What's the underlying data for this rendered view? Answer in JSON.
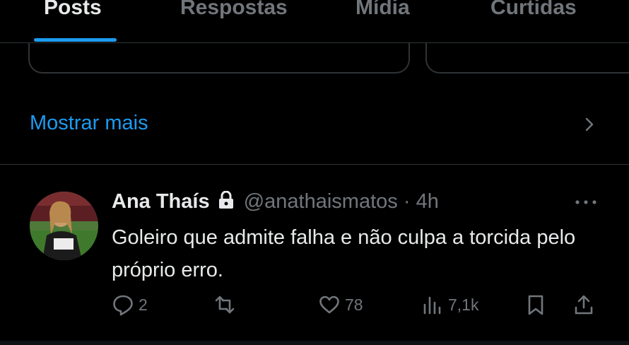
{
  "tabs": [
    {
      "label": "Posts",
      "active": true
    },
    {
      "label": "Respostas",
      "active": false
    },
    {
      "label": "Mídia",
      "active": false
    },
    {
      "label": "Curtidas",
      "active": false
    }
  ],
  "show_more": {
    "label": "Mostrar mais"
  },
  "tweet": {
    "display_name": "Ana Thaís",
    "handle": "@anathaismatos",
    "separator": "·",
    "time": "4h",
    "text": "Goleiro que admite falha e não culpa a torcida pelo próprio erro.",
    "replies": "2",
    "retweets": "",
    "likes": "78",
    "views": "7,1k",
    "protected_account": true
  },
  "icons": [
    "lock-icon",
    "more-icon",
    "reply-icon",
    "retweet-icon",
    "like-icon",
    "views-icon",
    "bookmark-icon",
    "share-icon",
    "chevron-right-icon"
  ],
  "colors": {
    "background": "#000000",
    "primary_text": "#e7e9ea",
    "secondary_text": "#71767b",
    "accent": "#1d9bf0",
    "divider": "#2f3336"
  }
}
